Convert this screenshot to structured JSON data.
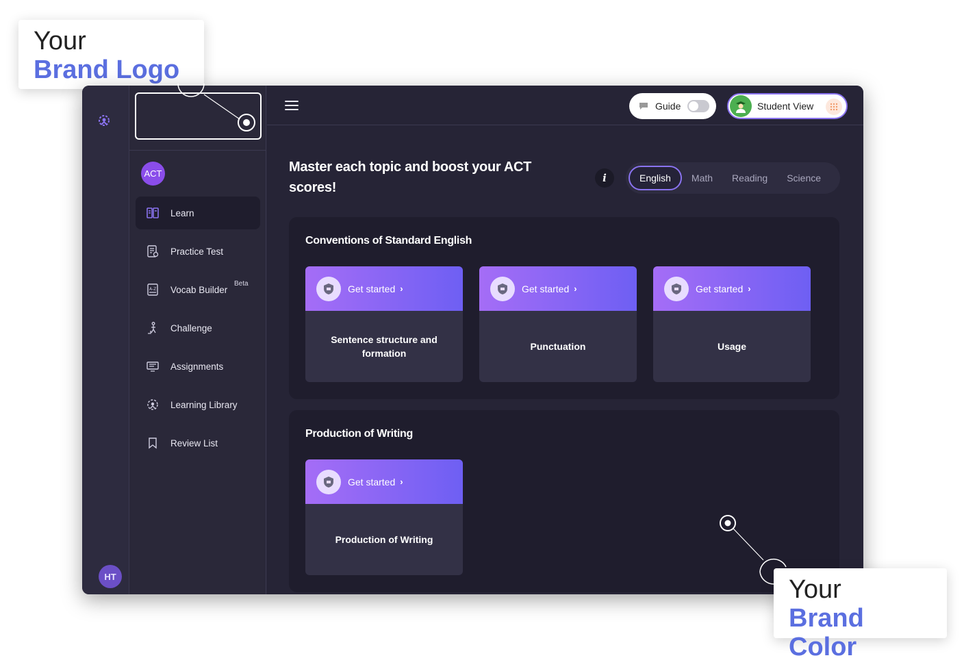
{
  "annotations": {
    "logo_callout": {
      "line1": "Your",
      "line2": "Brand Logo"
    },
    "color_callout": {
      "line1": "Your",
      "line2": "Brand Color"
    }
  },
  "rail": {
    "user_initials": "HT",
    "logo_icon": "brain-logo-icon"
  },
  "sidebar": {
    "exam_badge": "ACT",
    "items": [
      {
        "label": "Learn",
        "icon": "book-icon",
        "active": true
      },
      {
        "label": "Practice Test",
        "icon": "checklist-icon"
      },
      {
        "label": "Vocab Builder",
        "icon": "dictionary-icon",
        "badge": "Beta"
      },
      {
        "label": "Challenge",
        "icon": "climber-icon"
      },
      {
        "label": "Assignments",
        "icon": "assignment-icon"
      },
      {
        "label": "Learning Library",
        "icon": "brain-icon"
      },
      {
        "label": "Review List",
        "icon": "bookmark-icon"
      }
    ]
  },
  "topbar": {
    "guide_label": "Guide",
    "guide_on": false,
    "student_view_label": "Student View"
  },
  "main": {
    "headline": "Master each topic and boost your ACT scores!",
    "subjects": [
      {
        "label": "English",
        "active": true
      },
      {
        "label": "Math"
      },
      {
        "label": "Reading"
      },
      {
        "label": "Science"
      }
    ],
    "sections": [
      {
        "title": "Conventions of Standard English",
        "cards": [
          {
            "cta": "Get started",
            "topic": "Sentence structure and formation"
          },
          {
            "cta": "Get started",
            "topic": "Punctuation"
          },
          {
            "cta": "Get started",
            "topic": "Usage"
          }
        ]
      },
      {
        "title": "Production of Writing",
        "cards": [
          {
            "cta": "Get started",
            "topic": "Production of Writing"
          }
        ]
      }
    ]
  },
  "colors": {
    "accent": "#8a73f0",
    "card_gradient_start": "#a56df6",
    "card_gradient_end": "#6e5ff3",
    "annotation_blue": "#5b6fe0"
  }
}
